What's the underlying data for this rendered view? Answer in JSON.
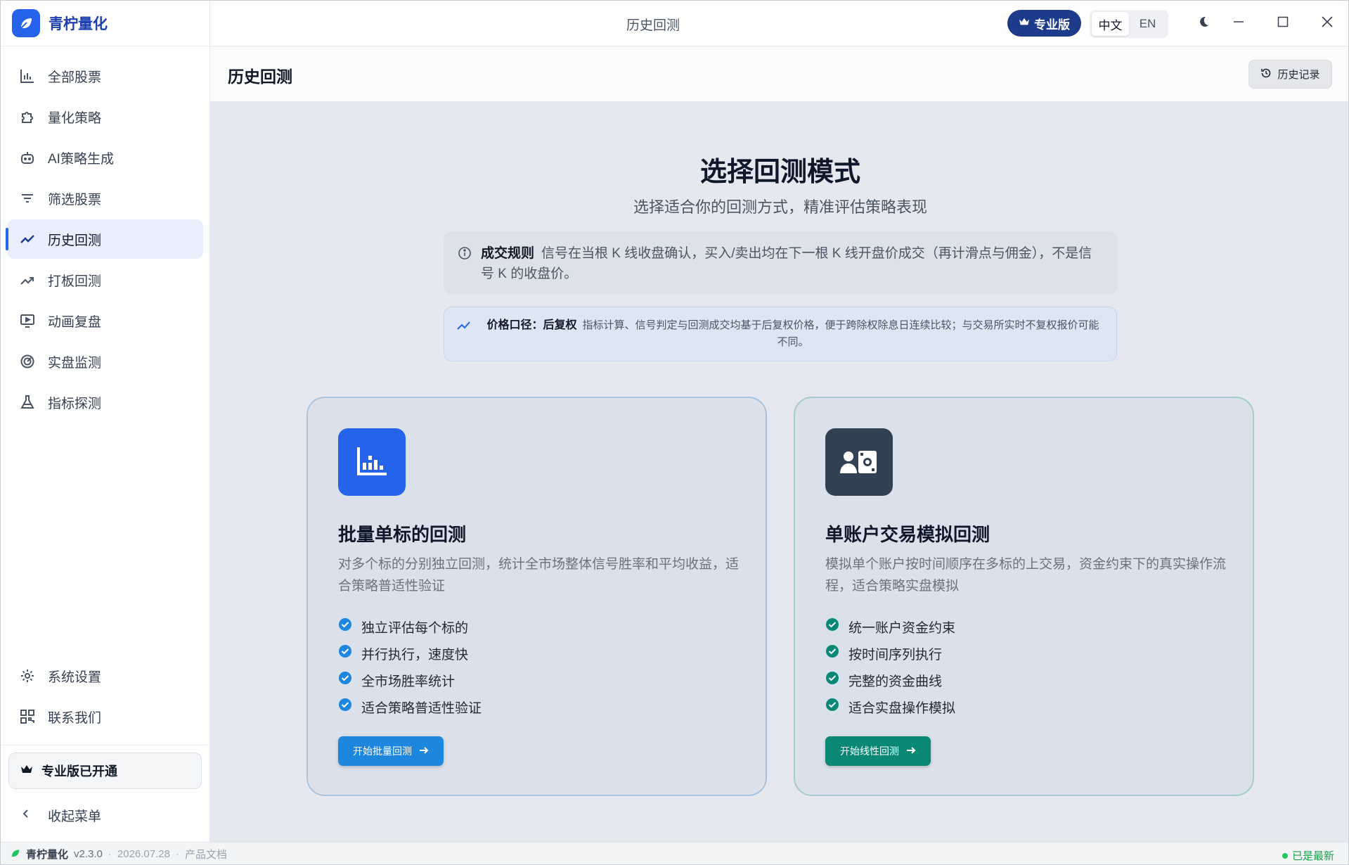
{
  "app": {
    "name": "青柠量化",
    "window_title": "历史回测"
  },
  "titlebar": {
    "pro_label": "专业版",
    "lang_zh": "中文",
    "lang_en": "EN",
    "selected_lang": "中文"
  },
  "sidebar": {
    "items": [
      {
        "label": "全部股票",
        "icon": "bar-chart-icon"
      },
      {
        "label": "量化策略",
        "icon": "puzzle-icon"
      },
      {
        "label": "AI策略生成",
        "icon": "robot-icon"
      },
      {
        "label": "筛选股票",
        "icon": "filter-icon"
      },
      {
        "label": "历史回测",
        "icon": "trend-line-icon",
        "active": true
      },
      {
        "label": "打板回测",
        "icon": "trending-up-icon"
      },
      {
        "label": "动画复盘",
        "icon": "monitor-play-icon"
      },
      {
        "label": "实盘监测",
        "icon": "radar-icon"
      },
      {
        "label": "指标探测",
        "icon": "flask-icon"
      }
    ],
    "bottom_items": [
      {
        "label": "系统设置",
        "icon": "gear-icon"
      },
      {
        "label": "联系我们",
        "icon": "qr-code-icon"
      }
    ],
    "pro_status": "专业版已开通",
    "collapse_label": "收起菜单"
  },
  "header": {
    "title": "历史回测",
    "history_button": "历史记录"
  },
  "main": {
    "title": "选择回测模式",
    "subtitle": "选择适合你的回测方式，精准评估策略表现",
    "rule": {
      "label": "成交规则",
      "text": "信号在当根 K 线收盘确认，买入/卖出均在下一根 K 线开盘价成交（再计滑点与佣金），不是信号 K 的收盘价。"
    },
    "price": {
      "label": "价格口径：后复权",
      "text": "指标计算、信号判定与回测成交均基于后复权价格，便于跨除权除息日连续比较；与交易所实时不复权报价可能不同。"
    },
    "cards": [
      {
        "title": "批量单标的回测",
        "description": "对多个标的分别独立回测，统计全市场整体信号胜率和平均收益，适合策略普适性验证",
        "features": [
          "独立评估每个标的",
          "并行执行，速度快",
          "全市场胜率统计",
          "适合策略普适性验证"
        ],
        "button": "开始批量回测",
        "accent": "#1d87e0"
      },
      {
        "title": "单账户交易模拟回测",
        "description": "模拟单个账户按时间顺序在多标的上交易，资金约束下的真实操作流程，适合策略实盘模拟",
        "features": [
          "统一账户资金约束",
          "按时间序列执行",
          "完整的资金曲线",
          "适合实盘操作模拟"
        ],
        "button": "开始线性回测",
        "accent": "#0a8876"
      }
    ]
  },
  "statusbar": {
    "app_name": "青柠量化",
    "version": "v2.3.0",
    "date": "2026.07.28",
    "docs": "产品文档",
    "update_status": "已是最新"
  }
}
